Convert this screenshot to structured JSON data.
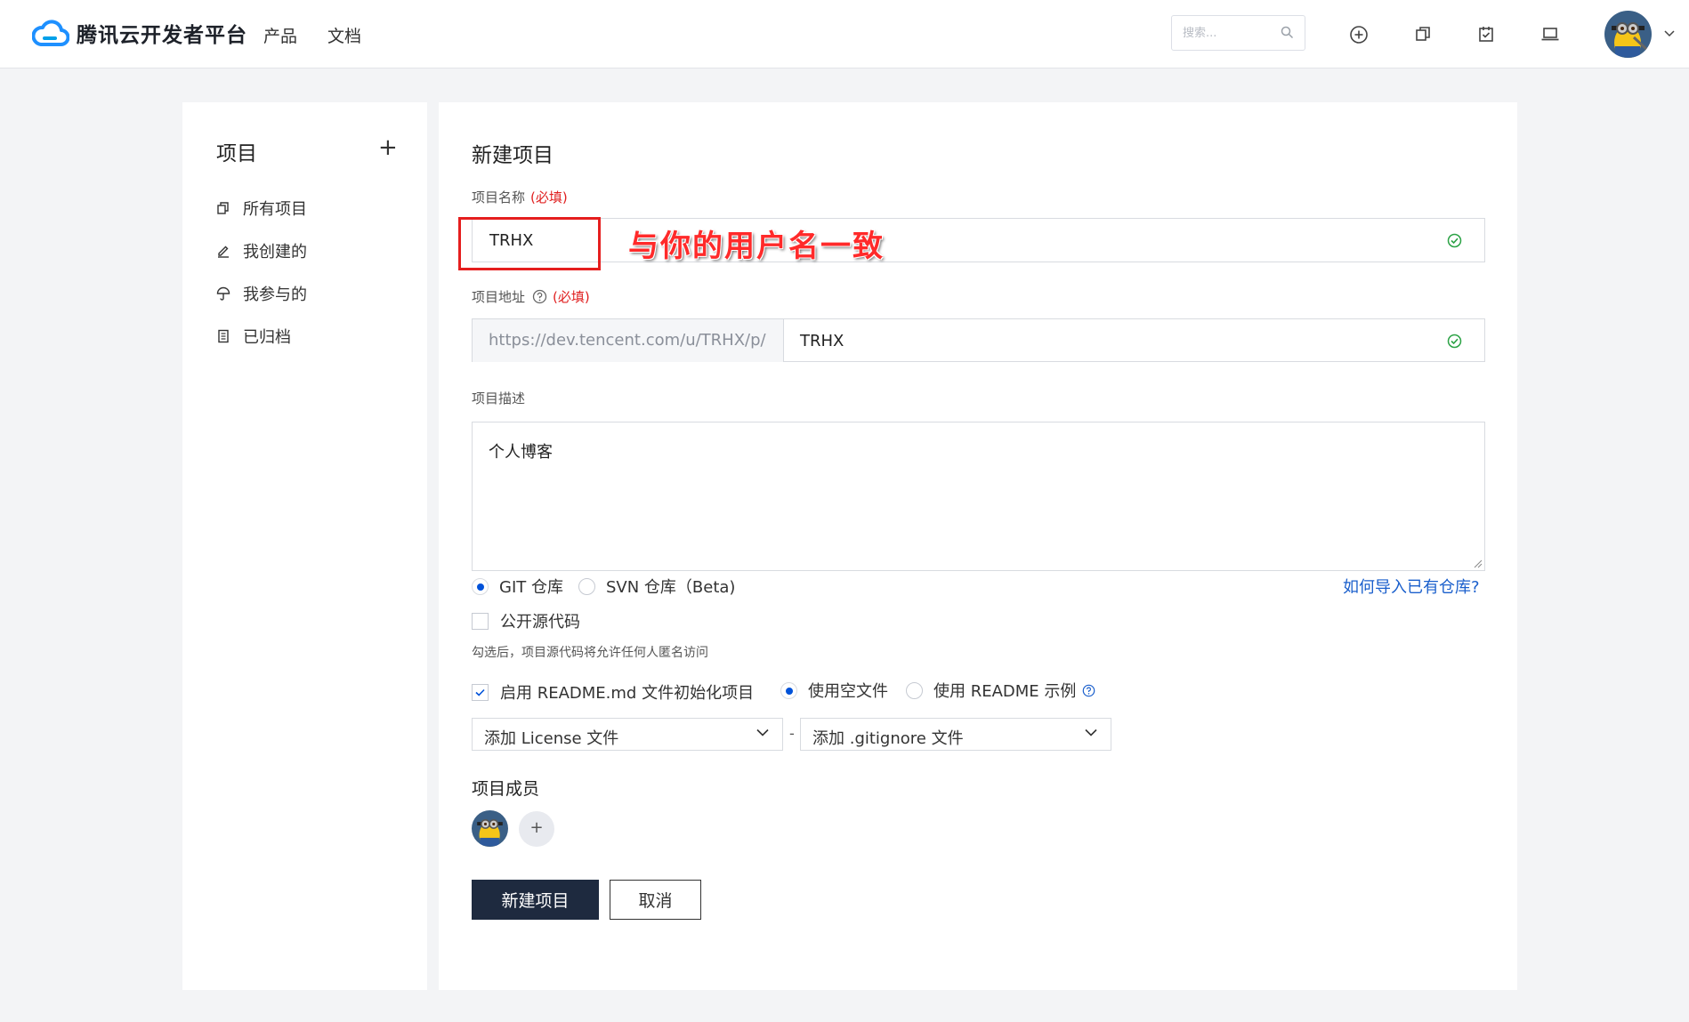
{
  "header": {
    "brand": "腾讯云开发者平台",
    "nav": [
      "产品",
      "文档"
    ],
    "search_placeholder": "搜索..."
  },
  "sidebar": {
    "title": "项目",
    "add_symbol": "+",
    "items": [
      {
        "label": "所有项目",
        "icon": "copy-icon"
      },
      {
        "label": "我创建的",
        "icon": "edit-icon"
      },
      {
        "label": "我参与的",
        "icon": "umbrella-icon"
      },
      {
        "label": "已归档",
        "icon": "archive-icon"
      }
    ]
  },
  "form": {
    "title": "新建项目",
    "required_mark": "(必填)",
    "name": {
      "label": "项目名称",
      "value": "TRHX"
    },
    "address": {
      "label": "项目地址",
      "prefix": "https://dev.tencent.com/u/TRHX/p/",
      "value": "TRHX"
    },
    "description": {
      "label": "项目描述",
      "value": "个人博客"
    },
    "repo_type": {
      "options": [
        "GIT 仓库",
        "SVN 仓库（Beta)"
      ],
      "selected": 0
    },
    "import_link": "如何导入已有仓库?",
    "public_label": "公开源代码",
    "public_hint": "勾选后，项目源代码将允许任何人匿名访问",
    "readme_label": "启用 README.md 文件初始化项目",
    "readme_options": [
      "使用空文件",
      "使用 README 示例"
    ],
    "readme_selected": 0,
    "license_select": "添加 License 文件",
    "gitignore_select": "添加 .gitignore 文件",
    "separator": "-",
    "members_title": "项目成员",
    "add_member": "+",
    "submit": "新建项目",
    "cancel": "取消"
  },
  "annotation": {
    "text": "与你的用户名一致",
    "color": "#e51e1e"
  },
  "colors": {
    "primary_button": "#1e2a3f",
    "link": "#1a5fcc",
    "required": "#e02020",
    "success": "#2ba245",
    "radio_active": "#0052d9"
  }
}
